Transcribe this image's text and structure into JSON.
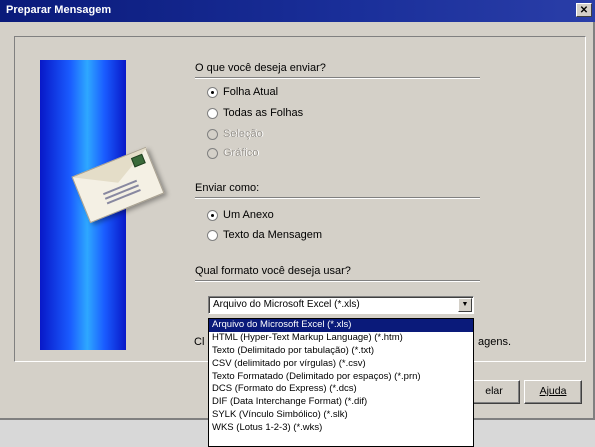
{
  "window": {
    "title": "Preparar Mensagem",
    "close": "✕"
  },
  "what_to_send": {
    "heading": "O que você deseja enviar?",
    "options": [
      {
        "label": "Folha Atual",
        "checked": true,
        "enabled": true
      },
      {
        "label": "Todas as Folhas",
        "checked": false,
        "enabled": true
      },
      {
        "label": "Seleção",
        "checked": false,
        "enabled": false
      },
      {
        "label": "Gráfico",
        "checked": false,
        "enabled": false
      }
    ]
  },
  "send_as": {
    "heading": "Enviar como:",
    "options": [
      {
        "label": "Um Anexo",
        "checked": true
      },
      {
        "label": "Texto da Mensagem",
        "checked": false
      }
    ]
  },
  "format": {
    "heading": "Qual formato você deseja usar?",
    "selected": "Arquivo do Microsoft Excel (*.xls)",
    "options": [
      "Arquivo do Microsoft Excel (*.xls)",
      "HTML (Hyper-Text Markup Language) (*.htm)",
      "Texto (Delimitado por tabulação) (*.txt)",
      "CSV (delimitado por vírgulas) (*.csv)",
      "Texto Formatado (Delimitado por espaços) (*.prn)",
      "DCS (Formato do Express) (*.dcs)",
      "DIF (Data Interchange Format) (*.dif)",
      "SYLK (Vínculo Simbólico) (*.slk)",
      "WKS (Lotus 1-2-3) (*.wks)"
    ]
  },
  "partial_text": {
    "left": "Cl",
    "right": "agens."
  },
  "buttons": {
    "cancel_partial": "elar",
    "help": "Ajuda"
  },
  "colors": {
    "titlebar": "#0a1a7a",
    "dialog": "#d4d0c8",
    "selection": "#0a1a7a"
  }
}
